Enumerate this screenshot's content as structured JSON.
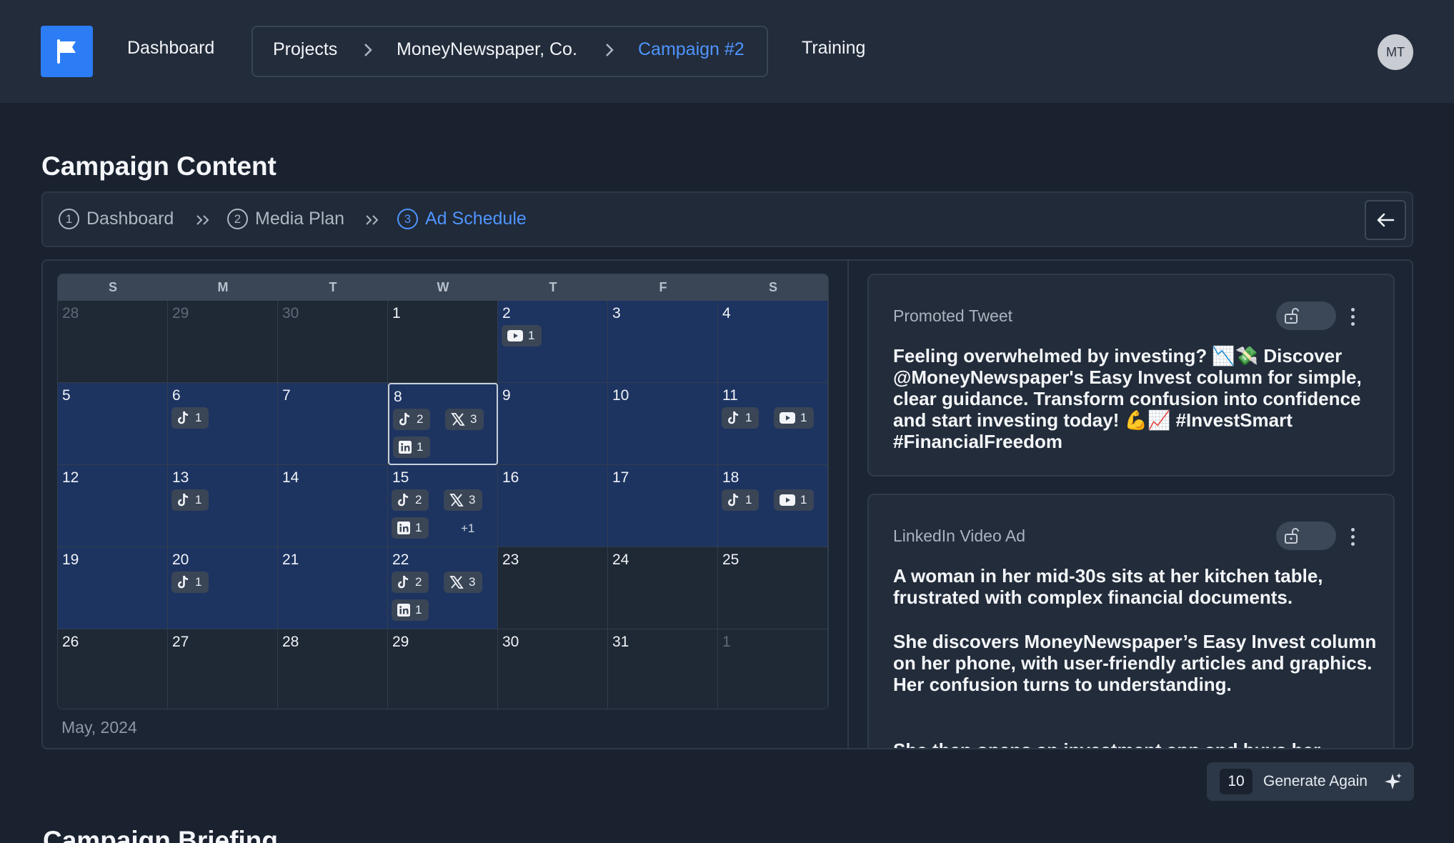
{
  "nav": {
    "dashboard": "Dashboard",
    "breadcrumbs": [
      "Projects",
      "MoneyNewspaper, Co.",
      "Campaign #2"
    ],
    "training": "Training",
    "avatar_initials": "MT"
  },
  "page_title": "Campaign Content",
  "steps": [
    {
      "num": "1",
      "label": "Dashboard"
    },
    {
      "num": "2",
      "label": "Media Plan"
    },
    {
      "num": "3",
      "label": "Ad Schedule"
    }
  ],
  "calendar": {
    "weekdays": [
      "S",
      "M",
      "T",
      "W",
      "T",
      "F",
      "S"
    ],
    "month_label": "May, 2024",
    "weeks": [
      [
        {
          "d": "28",
          "muted": true
        },
        {
          "d": "29",
          "muted": true
        },
        {
          "d": "30",
          "muted": true
        },
        {
          "d": "1"
        },
        {
          "d": "2",
          "hl": true,
          "chips": [
            {
              "icon": "youtube",
              "n": "1"
            }
          ]
        },
        {
          "d": "3",
          "hl": true
        },
        {
          "d": "4",
          "hl": true
        }
      ],
      [
        {
          "d": "5",
          "hl": true
        },
        {
          "d": "6",
          "hl": true,
          "chips": [
            {
              "icon": "tiktok",
              "n": "1"
            }
          ]
        },
        {
          "d": "7",
          "hl": true
        },
        {
          "d": "8",
          "hl": true,
          "sel": true,
          "chips": [
            {
              "icon": "tiktok",
              "n": "2"
            },
            {
              "icon": "x",
              "n": "3"
            },
            {
              "icon": "linkedin",
              "n": "1"
            }
          ]
        },
        {
          "d": "9",
          "hl": true
        },
        {
          "d": "10",
          "hl": true
        },
        {
          "d": "11",
          "hl": true,
          "chips": [
            {
              "icon": "tiktok",
              "n": "1"
            },
            {
              "icon": "youtube",
              "n": "1"
            }
          ]
        }
      ],
      [
        {
          "d": "12",
          "hl": true
        },
        {
          "d": "13",
          "hl": true,
          "chips": [
            {
              "icon": "tiktok",
              "n": "1"
            }
          ]
        },
        {
          "d": "14",
          "hl": true
        },
        {
          "d": "15",
          "hl": true,
          "chips": [
            {
              "icon": "tiktok",
              "n": "2"
            },
            {
              "icon": "x",
              "n": "3"
            },
            {
              "icon": "linkedin",
              "n": "1"
            }
          ],
          "more": "+1"
        },
        {
          "d": "16",
          "hl": true
        },
        {
          "d": "17",
          "hl": true
        },
        {
          "d": "18",
          "hl": true,
          "chips": [
            {
              "icon": "tiktok",
              "n": "1"
            },
            {
              "icon": "youtube",
              "n": "1"
            }
          ]
        }
      ],
      [
        {
          "d": "19",
          "hl": true
        },
        {
          "d": "20",
          "hl": true,
          "chips": [
            {
              "icon": "tiktok",
              "n": "1"
            }
          ]
        },
        {
          "d": "21",
          "hl": true
        },
        {
          "d": "22",
          "hl": true,
          "chips": [
            {
              "icon": "tiktok",
              "n": "2"
            },
            {
              "icon": "x",
              "n": "3"
            },
            {
              "icon": "linkedin",
              "n": "1"
            }
          ]
        },
        {
          "d": "23"
        },
        {
          "d": "24"
        },
        {
          "d": "25"
        }
      ],
      [
        {
          "d": "26"
        },
        {
          "d": "27"
        },
        {
          "d": "28"
        },
        {
          "d": "29"
        },
        {
          "d": "30"
        },
        {
          "d": "31"
        },
        {
          "d": "1",
          "muted": true
        }
      ]
    ]
  },
  "ads": [
    {
      "type": "Promoted Tweet",
      "text": "Feeling overwhelmed by investing? 📉💸 Discover @MoneyNewspaper's Easy Invest column for simple, clear guidance. Transform confusion into confidence and start investing today! 💪📈 #InvestSmart #FinancialFreedom"
    },
    {
      "type": "LinkedIn Video Ad",
      "paragraphs": [
        "A woman in her mid-30s sits at her kitchen table, frustrated with complex financial documents.",
        "She discovers MoneyNewspaper’s Easy Invest column on her phone, with user-friendly articles and graphics. Her confusion turns to understanding.",
        "She then opens an investment app and buys her"
      ]
    }
  ],
  "generate": {
    "count": "10",
    "label": "Generate Again"
  },
  "section2_title": "Campaign Briefing"
}
